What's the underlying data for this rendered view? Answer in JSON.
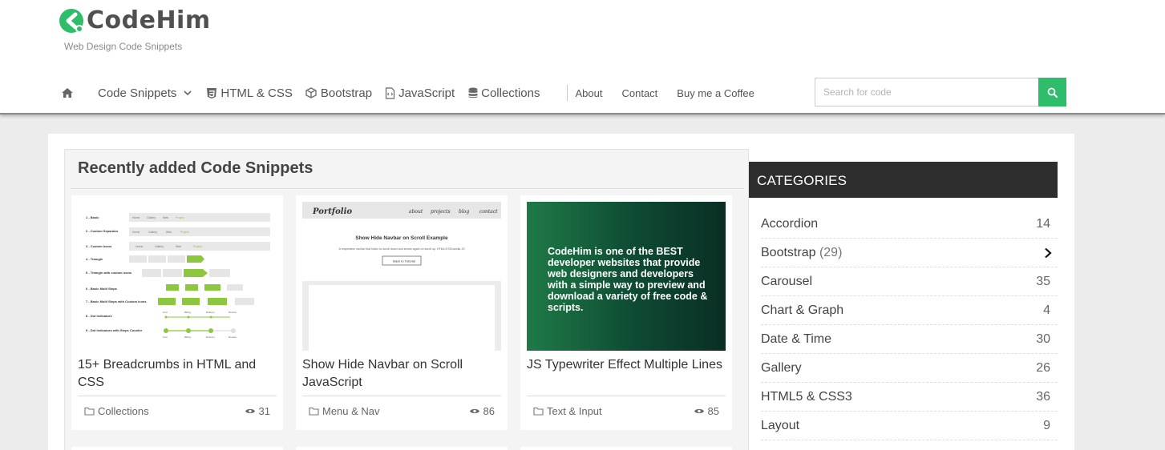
{
  "header": {
    "logo_text": "CodeHim",
    "tagline": "Web Design Code Snippets",
    "logo_color": "#2ebd6b"
  },
  "nav": {
    "home_icon": "home-icon",
    "items": [
      {
        "label": "Code Snippets",
        "icon": "chevron-down-icon"
      },
      {
        "label": "HTML & CSS",
        "icon": "html5-icon"
      },
      {
        "label": "Bootstrap",
        "icon": "cube-icon"
      },
      {
        "label": "JavaScript",
        "icon": "file-code-icon"
      },
      {
        "label": "Collections",
        "icon": "database-icon"
      }
    ],
    "links": [
      "About",
      "Contact",
      "Buy me a Coffee"
    ]
  },
  "search": {
    "placeholder": "Search for code",
    "button_icon": "search-icon",
    "button_color": "#2ebd6b"
  },
  "main": {
    "title": "Recently added Code Snippets",
    "cards": [
      {
        "title": "15+ Breadcrumbs in HTML and CSS",
        "category": "Collections",
        "views": "31"
      },
      {
        "title": "Show Hide Navbar on Scroll JavaScript",
        "category": "Menu & Nav",
        "views": "86"
      },
      {
        "title": "JS Typewriter Effect Multiple Lines",
        "category": "Text & Input",
        "views": "85"
      }
    ],
    "thumb2": {
      "brand": "Portfolio",
      "links": [
        "about",
        "projects",
        "blog",
        "contact"
      ],
      "heading": "Show Hide Navbar on Scroll Example",
      "sub": "A responsive navbar that hides on scroll down and shows again on scroll up. HTML/CSS/vanilla JS",
      "button": "Back to Tutorial"
    },
    "thumb3": {
      "text": "CodeHim is one of the BEST developer websites that provide web designers and developers with a simple way to preview and download a variety of free code & scripts."
    },
    "thumb1": {
      "rows": [
        "1 - Basic",
        "2 - Custom Separator",
        "3 - Custom Icons",
        "4 - Triangle",
        "5 - Triangle with custom icons",
        "6 - Basic Multi Steps",
        "7 - Basic Multi Steps with Custom Icons",
        "8 - Dot Indicators",
        "9 - Dot Indicators with Steps Counter"
      ],
      "crumbs": [
        "Home",
        "Gallery",
        "Web",
        "Project"
      ],
      "steps": [
        "Cart",
        "Billing",
        "Delivery",
        "Review"
      ],
      "accent": "#8dc63f"
    }
  },
  "sidebar": {
    "header": "CATEGORIES",
    "categories": [
      {
        "name": "Accordion",
        "count": "14"
      },
      {
        "name": "Bootstrap",
        "count": "(29)"
      },
      {
        "name": "Carousel",
        "count": "35"
      },
      {
        "name": "Chart & Graph",
        "count": "4"
      },
      {
        "name": "Date & Time",
        "count": "30"
      },
      {
        "name": "Gallery",
        "count": "26"
      },
      {
        "name": "HTML5 & CSS3",
        "count": "36"
      },
      {
        "name": "Layout",
        "count": "9"
      }
    ]
  }
}
